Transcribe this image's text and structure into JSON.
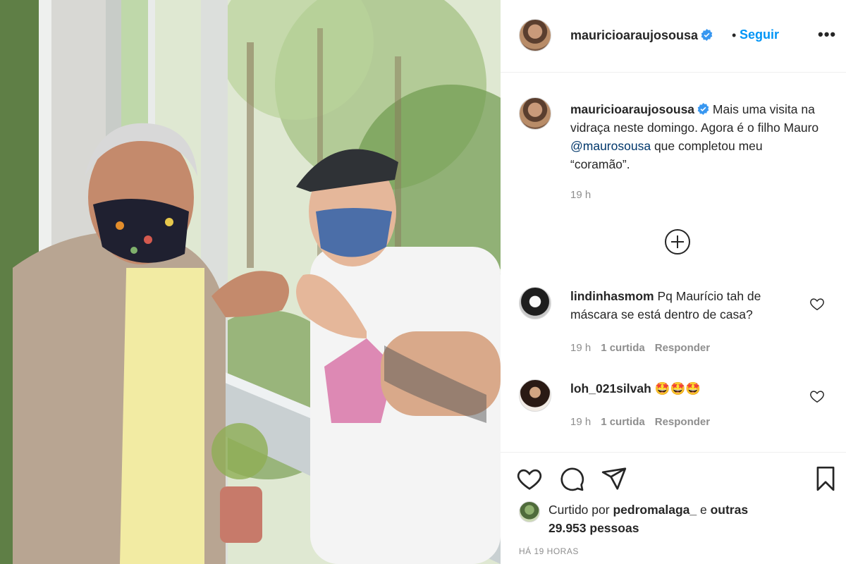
{
  "post": {
    "author": "mauricioaraujosousa",
    "follow_separator": "•",
    "follow_label": "Seguir",
    "more_label": "•••"
  },
  "caption": {
    "username": "mauricioaraujosousa",
    "text_before": "Mais uma visita na vidraça neste domingo. Agora é o filho Mauro ",
    "mention": "@maurosousa",
    "text_after": " que completou meu “coramão”.",
    "time": "19 h"
  },
  "comments": [
    {
      "username": "lindinhasmom",
      "text": "Pq Maurício tah de máscara se está dentro de casa?",
      "time": "19 h",
      "likes": "1 curtida",
      "reply_label": "Responder"
    },
    {
      "username": "loh_021silvah",
      "text": "🤩🤩🤩",
      "time": "19 h",
      "likes": "1 curtida",
      "reply_label": "Responder"
    }
  ],
  "likes": {
    "prefix": "Curtido por",
    "user": "pedromalaga_",
    "conjunction": "e",
    "others": "outras 29.953 pessoas"
  },
  "timestamp": "HÁ 19 HORAS",
  "colors": {
    "link_blue": "#0095f6",
    "mention_blue": "#00376b",
    "verified_blue": "#3897f0",
    "muted_gray": "#8e8e8e"
  },
  "icons": [
    "verified-icon",
    "plus-circle-icon",
    "heart-icon",
    "comment-icon",
    "share-icon",
    "bookmark-icon"
  ]
}
